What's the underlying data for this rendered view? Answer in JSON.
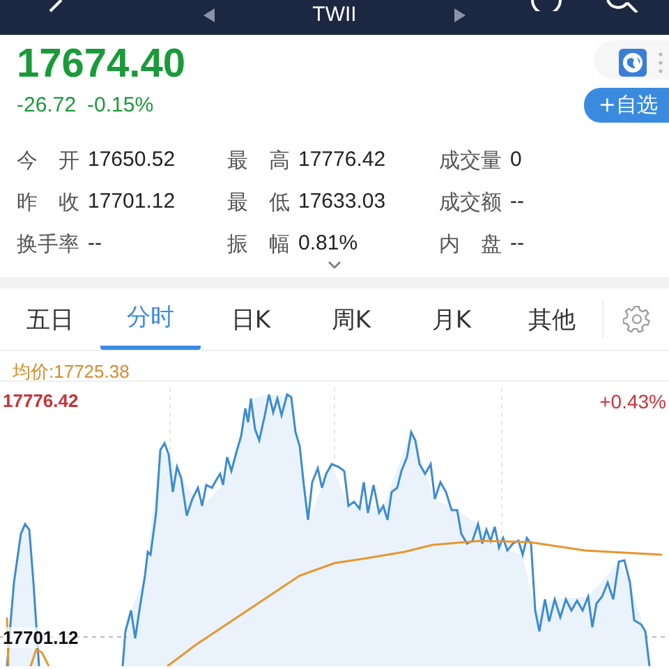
{
  "nav": {
    "title": "TWII"
  },
  "quote": {
    "price": "17674.40",
    "change": "-26.72",
    "change_percent": "-0.15%"
  },
  "watchlist_button": "+自选",
  "stats": [
    {
      "cells": [
        {
          "label": "今 开",
          "value": "17650.52"
        },
        {
          "label": "最 高",
          "value": "17776.42"
        },
        {
          "label": "成交量",
          "value": "0"
        }
      ]
    },
    {
      "cells": [
        {
          "label": "昨 收",
          "value": "17701.12"
        },
        {
          "label": "最 低",
          "value": "17633.03"
        },
        {
          "label": "成交额",
          "value": "--"
        }
      ]
    },
    {
      "cells": [
        {
          "label": "换手率",
          "value": "--"
        },
        {
          "label": "振 幅",
          "value": "0.81%"
        },
        {
          "label": "内 盘",
          "value": "--"
        }
      ]
    }
  ],
  "tabs": [
    {
      "label": "五日",
      "selected": false
    },
    {
      "label": "分时",
      "selected": true
    },
    {
      "label": "日K",
      "selected": false
    },
    {
      "label": "周K",
      "selected": false
    },
    {
      "label": "月K",
      "selected": false
    },
    {
      "label": "其他",
      "selected": false
    }
  ],
  "avg_price": "均价:17725.38",
  "chart": {
    "high_label": "17776.42",
    "high_percent": "+0.43%",
    "prev_close_label": "17701.12"
  }
}
